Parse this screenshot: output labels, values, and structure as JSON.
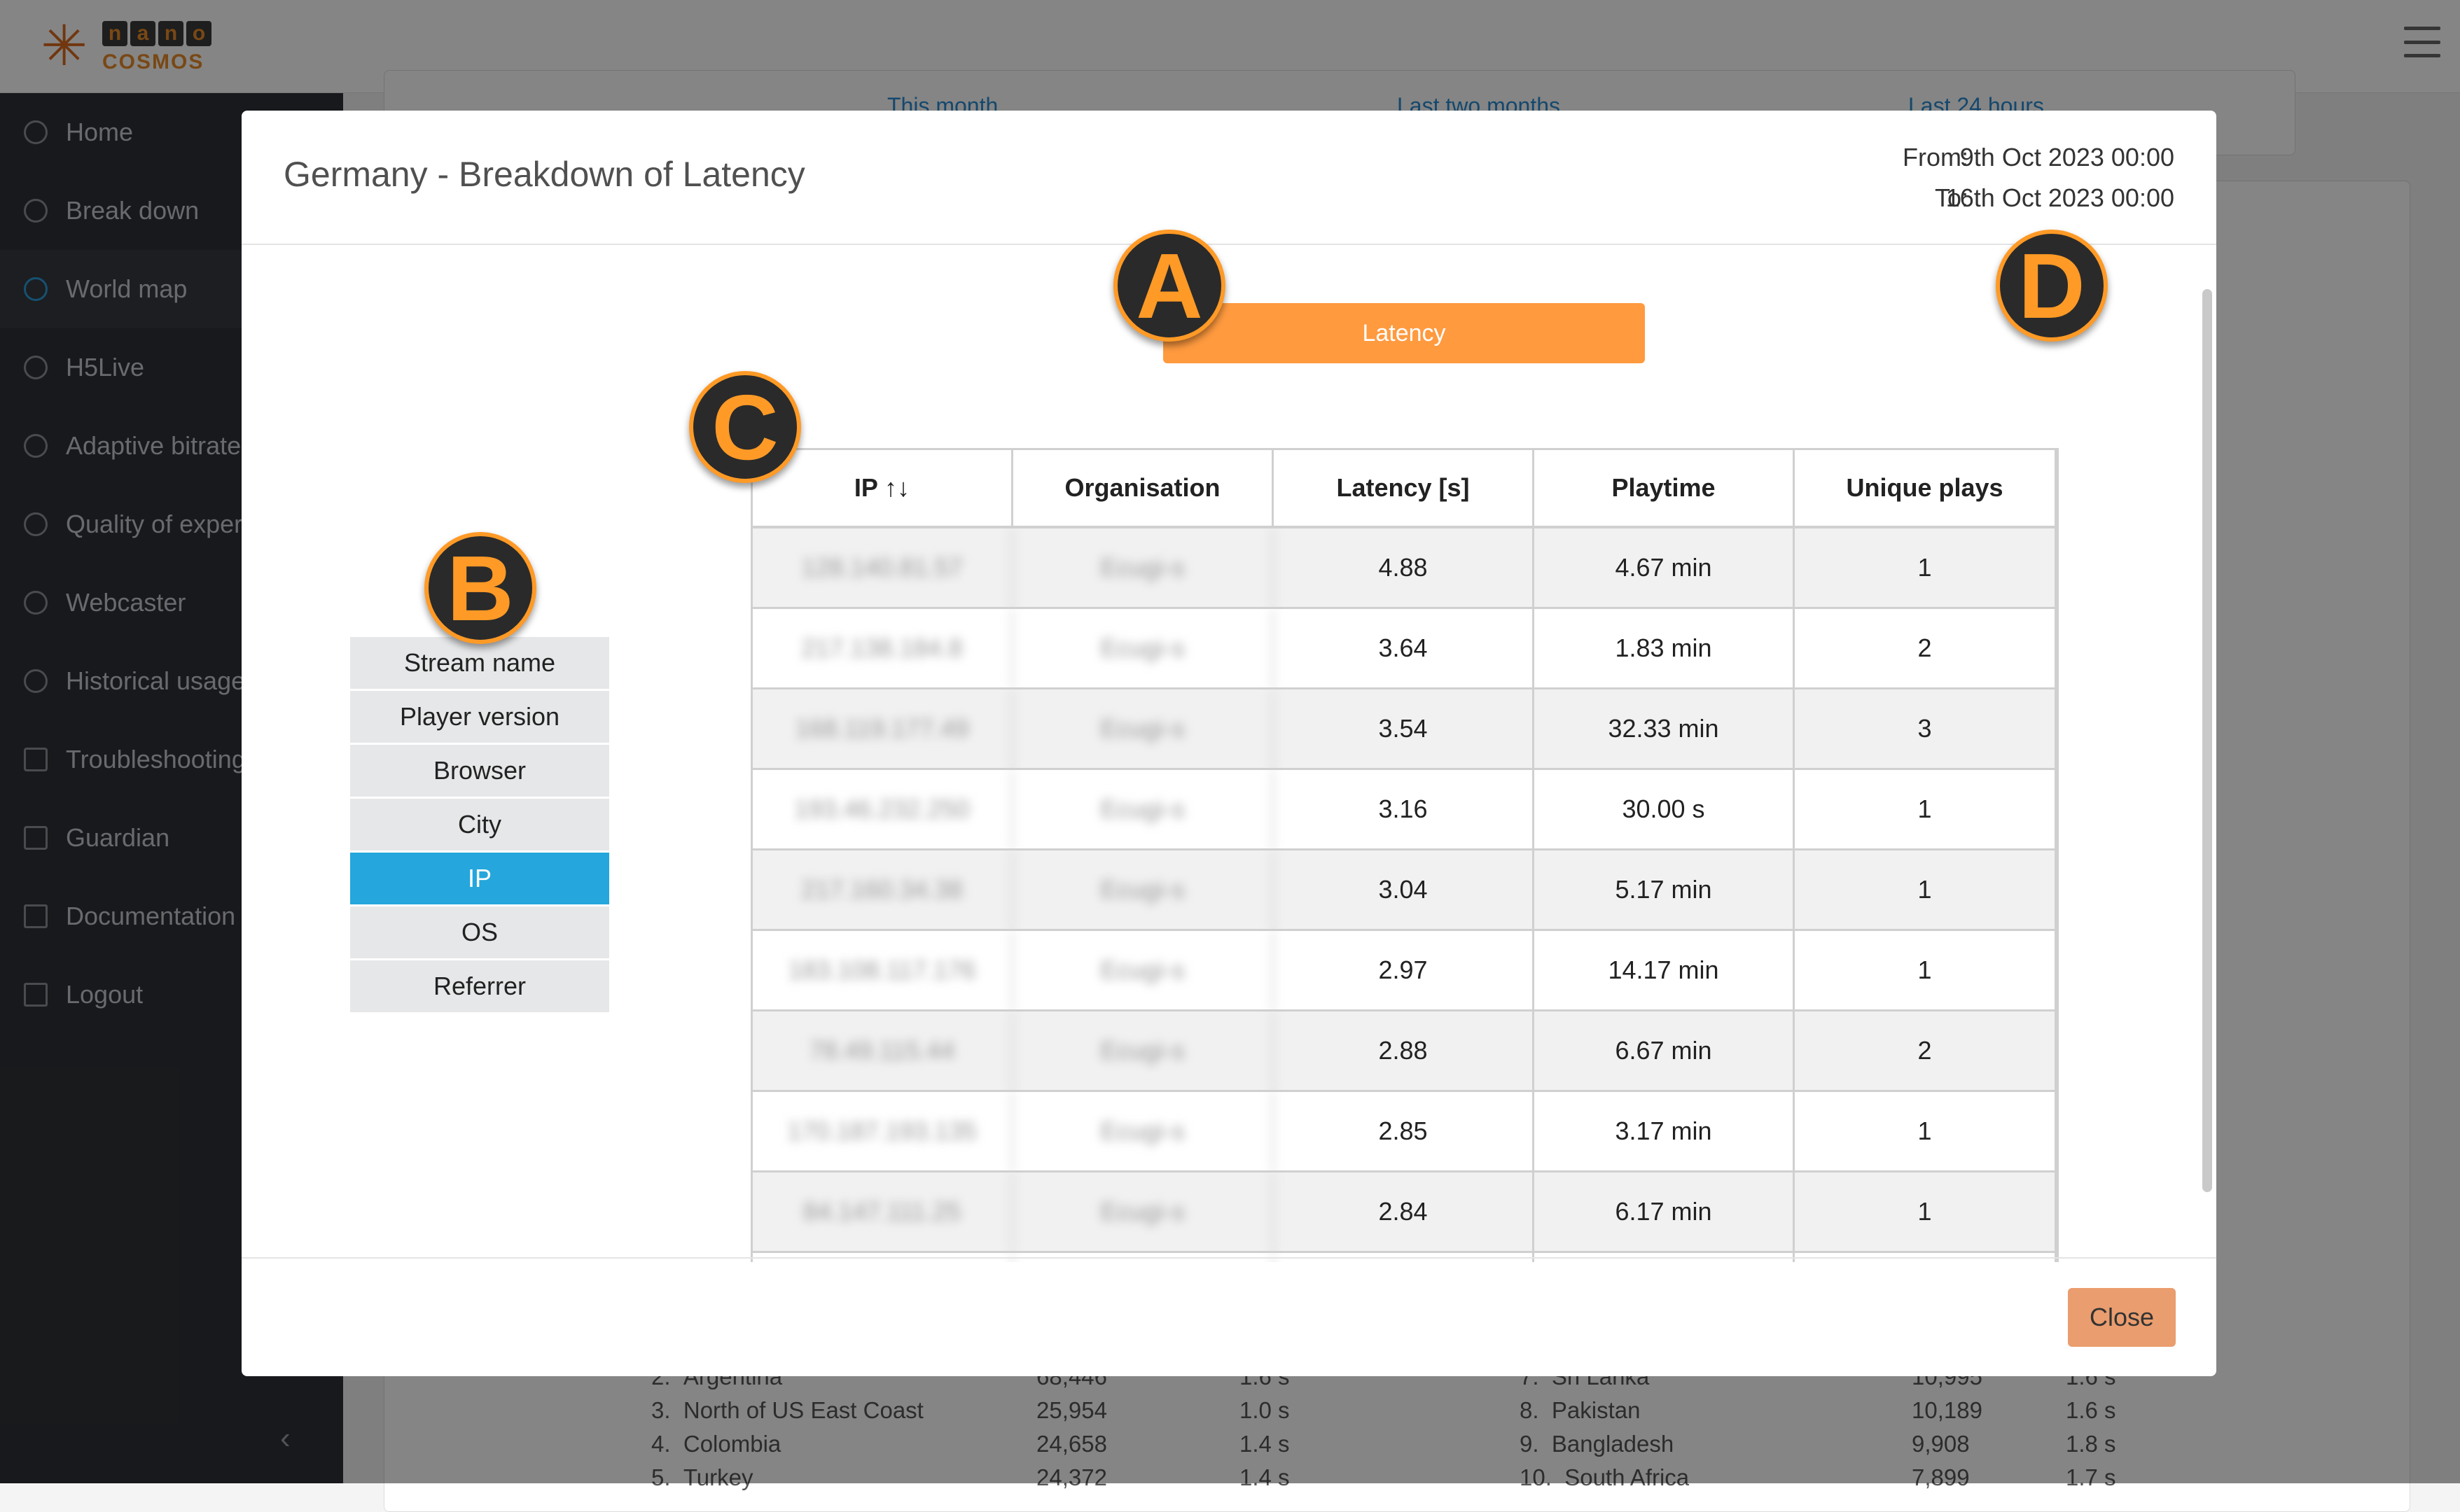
{
  "logo": {
    "letters": [
      "n",
      "a",
      "n",
      "o"
    ],
    "sub": "COSMOS"
  },
  "sidebar": {
    "items": [
      {
        "label": "Home",
        "icon": "dashboard-icon"
      },
      {
        "label": "Break down",
        "icon": "dashboard-icon"
      },
      {
        "label": "World map",
        "icon": "dashboard-icon"
      },
      {
        "label": "H5Live",
        "icon": "dashboard-icon"
      },
      {
        "label": "Adaptive bitrate",
        "icon": "dashboard-icon"
      },
      {
        "label": "Quality of exper",
        "icon": "dashboard-icon"
      },
      {
        "label": "Webcaster",
        "icon": "dashboard-icon"
      },
      {
        "label": "Historical usage",
        "icon": "clock-icon"
      },
      {
        "label": "Troubleshooting",
        "icon": "tools-icon"
      },
      {
        "label": "Guardian",
        "icon": "tools-icon"
      },
      {
        "label": "Documentation",
        "icon": "document-icon"
      },
      {
        "label": "Logout",
        "icon": "logout-icon"
      }
    ],
    "active_index": 2,
    "collapse_glyph": "‹"
  },
  "background": {
    "tabs": [
      "This month",
      "Last two months",
      "Last 24 hours"
    ],
    "list_left": [
      {
        "num": "2.",
        "name": "Argentina",
        "plays": "68,446",
        "lat": "1.6 s"
      },
      {
        "num": "3.",
        "name": "North of US East Coast",
        "plays": "25,954",
        "lat": "1.0 s"
      },
      {
        "num": "4.",
        "name": "Colombia",
        "plays": "24,658",
        "lat": "1.4 s"
      },
      {
        "num": "5.",
        "name": "Turkey",
        "plays": "24,372",
        "lat": "1.4 s"
      }
    ],
    "list_right": [
      {
        "num": "7.",
        "name": "Sri Lanka",
        "plays": "10,995",
        "lat": "1.6 s"
      },
      {
        "num": "8.",
        "name": "Pakistan",
        "plays": "10,189",
        "lat": "1.6 s"
      },
      {
        "num": "9.",
        "name": "Bangladesh",
        "plays": "9,908",
        "lat": "1.8 s"
      },
      {
        "num": "10.",
        "name": "South Africa",
        "plays": "7,899",
        "lat": "1.7 s"
      }
    ]
  },
  "modal": {
    "title": "Germany - Breakdown of Latency",
    "from_label": "From:",
    "from_value": "9th Oct 2023 00:00",
    "to_label": "To:",
    "to_value": "16th Oct 2023 00:00",
    "metric_button": "Latency",
    "close_label": "Close",
    "breakdown_menu": [
      "Stream name",
      "Player version",
      "Browser",
      "City",
      "IP",
      "OS",
      "Referrer"
    ],
    "breakdown_active_index": 4,
    "table": {
      "headers": [
        "IP ↑↓",
        "Organisation",
        "Latency [s]",
        "Playtime",
        "Unique plays"
      ],
      "rows": [
        [
          "128.140.81.57",
          "Ecugi-s",
          "4.88",
          "4.67 min",
          "1"
        ],
        [
          "217.138.184.8",
          "Ecugi-s",
          "3.64",
          "1.83 min",
          "2"
        ],
        [
          "168.119.177.49",
          "Ecugi-s",
          "3.54",
          "32.33 min",
          "3"
        ],
        [
          "193.46.232.250",
          "Ecugi-s",
          "3.16",
          "30.00 s",
          "1"
        ],
        [
          "217.160.34.38",
          "Ecugi-s",
          "3.04",
          "5.17 min",
          "1"
        ],
        [
          "183.108.117.176",
          "Ecugi-s",
          "2.97",
          "14.17 min",
          "1"
        ],
        [
          "78.49.115.44",
          "Ecugi-s",
          "2.88",
          "6.67 min",
          "2"
        ],
        [
          "170.187.193.135",
          "Ecugi-s",
          "2.85",
          "3.17 min",
          "1"
        ],
        [
          "84.147.111.25",
          "Ecugi-s",
          "2.84",
          "6.17 min",
          "1"
        ],
        [
          "",
          "",
          "",
          "",
          ""
        ]
      ]
    }
  },
  "callouts": [
    "A",
    "B",
    "C",
    "D"
  ],
  "colors": {
    "accent_orange": "#ff9a3f",
    "active_blue": "#25a6dc",
    "close_button": "#ea9d6e",
    "sidebar_bg": "#2e3136"
  }
}
